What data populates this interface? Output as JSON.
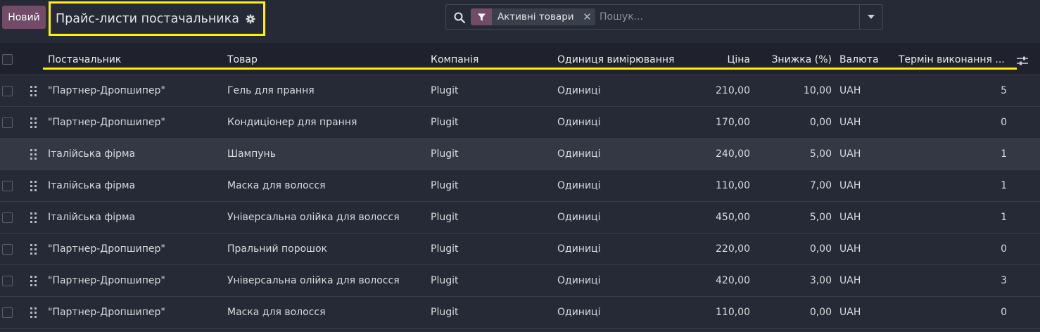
{
  "control_panel": {
    "new_button": "Новий",
    "title": "Прайс-листи постачальника",
    "search": {
      "facet_label": "Активні товари",
      "placeholder": "Пошук..."
    }
  },
  "table": {
    "columns": [
      "Постачальник",
      "Товар",
      "Компанія",
      "Одиниця вимірювання",
      "Ціна",
      "Знижка (%)",
      "Валюта",
      "Термін виконання ..."
    ],
    "rows": [
      {
        "vendor": "\"Партнер-Дропшипер\"",
        "product": "Гель для прання",
        "company": "Plugit",
        "uom": "Одиниці",
        "price": "210,00",
        "discount": "10,00",
        "currency": "UAH",
        "delay": "5"
      },
      {
        "vendor": "\"Партнер-Дропшипер\"",
        "product": "Кондиціонер для прання",
        "company": "Plugit",
        "uom": "Одиниці",
        "price": "170,00",
        "discount": "0,00",
        "currency": "UAH",
        "delay": "0"
      },
      {
        "vendor": "Італійська фірма",
        "product": "Шампунь",
        "company": "Plugit",
        "uom": "Одиниці",
        "price": "240,00",
        "discount": "5,00",
        "currency": "UAH",
        "delay": "1"
      },
      {
        "vendor": "Італійська фірма",
        "product": "Маска для волосся",
        "company": "Plugit",
        "uom": "Одиниці",
        "price": "110,00",
        "discount": "7,00",
        "currency": "UAH",
        "delay": "1"
      },
      {
        "vendor": "Італійська фірма",
        "product": "Універсальна олійка для волосся",
        "company": "Plugit",
        "uom": "Одиниці",
        "price": "450,00",
        "discount": "5,00",
        "currency": "UAH",
        "delay": "1"
      },
      {
        "vendor": "\"Партнер-Дропшипер\"",
        "product": "Пральний порошок",
        "company": "Plugit",
        "uom": "Одиниці",
        "price": "220,00",
        "discount": "0,00",
        "currency": "UAH",
        "delay": "0"
      },
      {
        "vendor": "\"Партнер-Дропшипер\"",
        "product": "Універсальна олійка для волосся",
        "company": "Plugit",
        "uom": "Одиниці",
        "price": "420,00",
        "discount": "3,00",
        "currency": "UAH",
        "delay": "3"
      },
      {
        "vendor": "\"Партнер-Дропшипер\"",
        "product": "Маска для волосся",
        "company": "Plugit",
        "uom": "Одиниці",
        "price": "110,00",
        "discount": "0,00",
        "currency": "UAH",
        "delay": "0"
      }
    ]
  },
  "colors": {
    "primary": "#714b67",
    "background": "#262a36",
    "highlight": "#fff200"
  },
  "icons": {
    "settings": "gear-icon",
    "search": "search-icon",
    "filter": "filter-icon",
    "remove_facet": "close-icon",
    "toggle_search": "caret-down-icon",
    "optional_columns": "sliders-icon",
    "row_handle": "drag-handle-icon"
  }
}
